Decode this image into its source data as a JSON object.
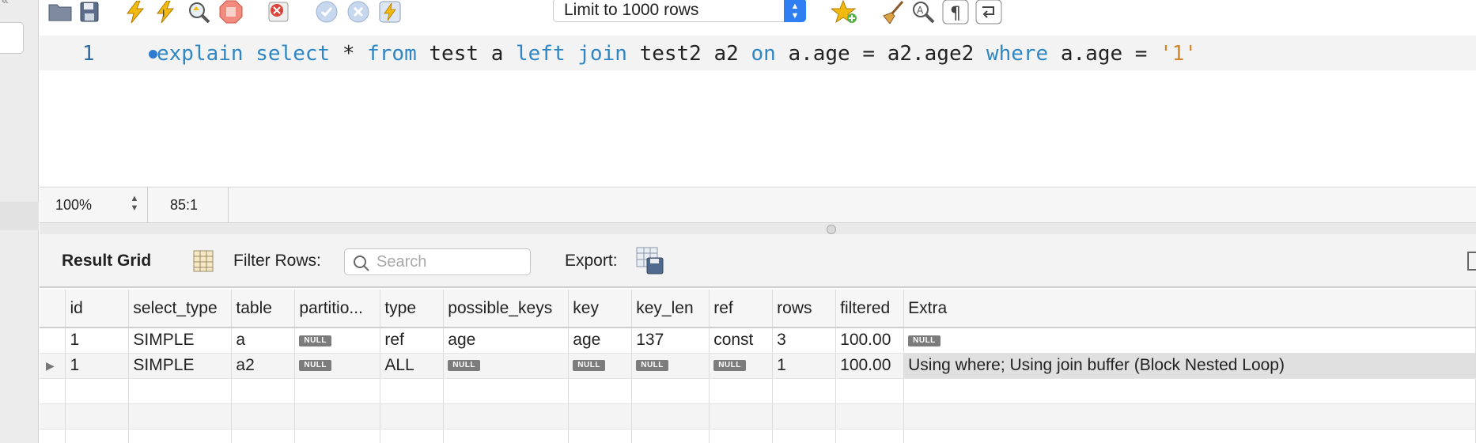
{
  "toolbar": {
    "icons": [
      "open-folder-icon",
      "save-icon",
      "execute-icon",
      "execute-current-icon",
      "explain-icon",
      "stop-icon",
      "toggle-error-stop-icon",
      "commit-icon",
      "rollback-icon",
      "autocommit-icon",
      "bookmark-icon",
      "beautify-icon",
      "find-icon",
      "invisibles-icon",
      "wrap-icon"
    ],
    "limit_label": "Limit to 1000 rows"
  },
  "editor": {
    "line_number": "1",
    "tokens": [
      "explain",
      "select",
      "*",
      "from",
      "test",
      "a",
      "left",
      "join",
      "test2",
      "a2",
      "on",
      "a.age",
      "=",
      "a2.age2",
      "where",
      "a.age",
      "=",
      "'1'"
    ]
  },
  "status": {
    "zoom": "100%",
    "cursor": "85:1"
  },
  "result_toolbar": {
    "title": "Result Grid",
    "filter_label": "Filter Rows:",
    "search_placeholder": "Search",
    "export_label": "Export:"
  },
  "grid": {
    "columns": [
      "id",
      "select_type",
      "table",
      "partitio...",
      "type",
      "possible_keys",
      "key",
      "key_len",
      "ref",
      "rows",
      "filtered",
      "Extra"
    ],
    "rows": [
      [
        "1",
        "SIMPLE",
        "a",
        "NULL",
        "ref",
        "age",
        "age",
        "137",
        "const",
        "3",
        "100.00",
        "NULL"
      ],
      [
        "1",
        "SIMPLE",
        "a2",
        "NULL",
        "ALL",
        "NULL",
        "NULL",
        "NULL",
        "NULL",
        "1",
        "100.00",
        "Using where; Using join buffer (Block Nested Loop)"
      ]
    ],
    "null_text": "NULL",
    "current_row_marker": "▶"
  },
  "colors": {
    "keyword": "#2f86c4",
    "string": "#d4872a",
    "accent": "#2f7ff3"
  }
}
